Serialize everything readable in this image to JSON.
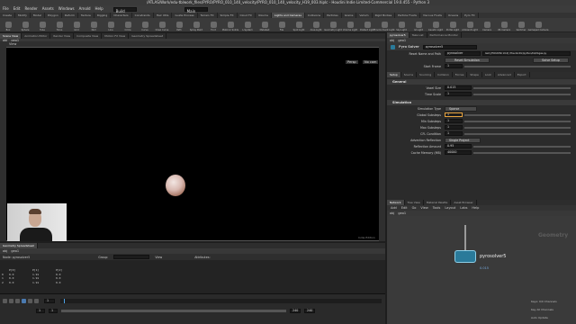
{
  "window": {
    "title": "/ATLAS/Work/edu-tb/work_files/PYRO/PYRO_010_140_velocity/PYRO_010_140_velocity_H19_003.hiplc - Houdini Indie Limited-Commercial 19.0.455 - Python 3"
  },
  "menu": [
    "File",
    "Edit",
    "Render",
    "Assets",
    "Windows",
    "Arnold",
    "Help"
  ],
  "desktop": {
    "value": "Build"
  },
  "main_desktop": {
    "value": "Main"
  },
  "shelf_tabs_left": [
    "Create",
    "Modify",
    "Model",
    "Polygon",
    "Deform",
    "Texture",
    "Rigging",
    "Characters",
    "Constraints",
    "Hair Utils",
    "Guide Process",
    "Terrain FX",
    "Simple FX",
    "Cloud FX",
    "Volume"
  ],
  "shelf_tabs_right": [
    "Lights and Cameras",
    "Collisions",
    "Particles",
    "Grains",
    "Vellum",
    "Rigid Bodies",
    "Particle Fluids",
    "Viscous Fluids",
    "Oceans",
    "Pyro FX",
    "Sparse Pyro FX",
    "FEM",
    "Wires",
    "Crowds",
    "Drive Simulation"
  ],
  "shelf_tools": [
    "Box",
    "Sphere",
    "Tube",
    "Torus",
    "Grid",
    "Null",
    "Line",
    "Circle",
    "Curve",
    "Draw Curve",
    "Path",
    "Spray Paint",
    "Font",
    "Platonic Solids",
    "L-System",
    "Metaball",
    "File",
    "Spot Light",
    "Area Light",
    "Geometry Light",
    "Volume Light",
    "Distant Light",
    "Environment Light",
    "Sky Light",
    "GI Light",
    "Caustic Light",
    "Portal Light",
    "Ambient Light",
    "Camera",
    "VR Camera",
    "Switcher",
    "Gamepad Camera"
  ],
  "left_tabs": [
    "Scene View",
    "Animation Editor",
    "Render View",
    "Composite View",
    "Motion FX View",
    "Geometry Spreadsheet"
  ],
  "path_left": [
    "obj",
    "geo1"
  ],
  "view_label": "View",
  "persp_label": "Persp",
  "cam_label": "No cam",
  "indie_label": "Indie Edition",
  "spreadsheet": {
    "tab": "Geometry Spreadsheet",
    "path": [
      "obj",
      "geo1"
    ],
    "node": "Node: pyrosolver5",
    "group_label": "Group:",
    "view_label": "View",
    "attributes_label": "Attributes:",
    "headers": [
      "",
      "P[0]",
      "P[1]",
      "P[2]"
    ],
    "rows": [
      [
        "0",
        "0.0",
        "1.91",
        "0.0"
      ],
      [
        "1",
        "0.0",
        "1.91",
        "0.0"
      ],
      [
        "2",
        "0.0",
        "1.91",
        "0.0"
      ]
    ]
  },
  "timeline": {
    "frame": "1",
    "start": "1",
    "end": "240",
    "end2": "240",
    "channels_label": "Keys: 0/0 Channels",
    "key_all": "Key All Channels",
    "auto_update": "Auto Update"
  },
  "right_tabs": [
    "pyrosolver5",
    "Take List",
    "Performance Monitor"
  ],
  "right_path": [
    "obj",
    "geo1"
  ],
  "node_header": {
    "type": "Pyro Solver",
    "name": "pyrosolver5"
  },
  "top_params": {
    "sim_name_label": "Reset Name and Path",
    "sim_name_value": "pyrosolver",
    "path_value": "Get [/HOUDINI 19.0] /HoudiniDir/python/lib/libgas.py",
    "reset_sim_button": "Reset Simulation",
    "solve_setup_button": "Solve Setup",
    "start_frame_label": "Start Frame",
    "start_frame_value": "1"
  },
  "param_tabs": [
    "Setup",
    "Source",
    "Sourcing",
    "Collision",
    "Forces",
    "Shape",
    "Look",
    "Advanced",
    "Export"
  ],
  "sections": {
    "general": "General",
    "simulation": "Simulation"
  },
  "general": [
    {
      "label": "Voxel Size",
      "value": "0.015"
    },
    {
      "label": "Time Scale",
      "value": "1"
    }
  ],
  "simulation": [
    {
      "label": "Simulation Type",
      "value": "Sparse"
    },
    {
      "label": "Global Substeps",
      "value": "1"
    },
    {
      "label": "Min Substeps",
      "value": "1"
    },
    {
      "label": "Max Substeps",
      "value": "1"
    },
    {
      "label": "CFL Condition",
      "value": "1"
    },
    {
      "label": "Advection Reflection",
      "value": "Single Project"
    },
    {
      "label": "Reflection Amount",
      "value": "0.95"
    },
    {
      "label": "Cache Memory (MB)",
      "value": "40000"
    }
  ],
  "network": {
    "tabs": [
      "Network",
      "Tree View",
      "Material Palette",
      "Asset Browser"
    ],
    "menu": [
      "Add",
      "Edit",
      "Go",
      "View",
      "Tools",
      "Layout",
      "Labs",
      "Help"
    ],
    "path": [
      "obj",
      "geo1"
    ],
    "watermark": "Geometry",
    "node_name": "pyrosolver5",
    "node_sub": "0.015"
  },
  "colors": {
    "accent": "#e8a33d",
    "node": "#2a7a9a"
  }
}
